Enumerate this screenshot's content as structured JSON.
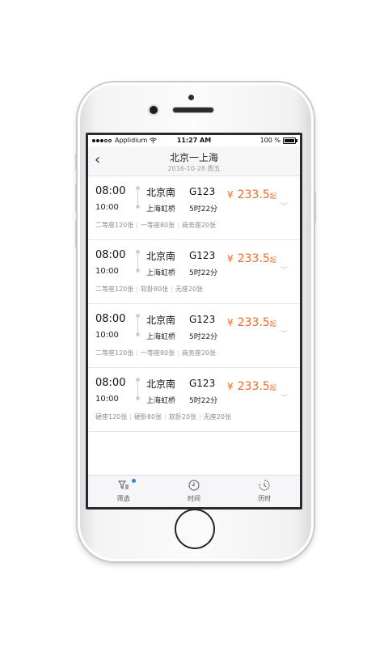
{
  "status_bar": {
    "carrier": "Applidium",
    "time": "11:27 AM",
    "battery": "100 %"
  },
  "nav": {
    "title": "北京一上海",
    "subtitle": "2016-10-28 周五"
  },
  "trains": [
    {
      "depart_time": "08:00",
      "arrive_time": "10:00",
      "from_station": "北京南",
      "to_station": "上海虹桥",
      "train_no": "G123",
      "duration": "5时22分",
      "currency": "¥",
      "price": "233.5",
      "price_suffix": "起",
      "seats": [
        "二等座120张",
        "一等座80张",
        "商务座20张"
      ]
    },
    {
      "depart_time": "08:00",
      "arrive_time": "10:00",
      "from_station": "北京南",
      "to_station": "上海虹桥",
      "train_no": "G123",
      "duration": "5时22分",
      "currency": "¥",
      "price": "233.5",
      "price_suffix": "起",
      "seats": [
        "二等座120张",
        "软卧80张",
        "无座20张"
      ]
    },
    {
      "depart_time": "08:00",
      "arrive_time": "10:00",
      "from_station": "北京南",
      "to_station": "上海虹桥",
      "train_no": "G123",
      "duration": "5时22分",
      "currency": "¥",
      "price": "233.5",
      "price_suffix": "起",
      "seats": [
        "二等座120张",
        "一等座80张",
        "商务座20张"
      ]
    },
    {
      "depart_time": "08:00",
      "arrive_time": "10:00",
      "from_station": "北京南",
      "to_station": "上海虹桥",
      "train_no": "G123",
      "duration": "5时22分",
      "currency": "¥",
      "price": "233.5",
      "price_suffix": "起",
      "seats": [
        "硬座120张",
        "硬卧80张",
        "软卧20张",
        "无座20张"
      ]
    }
  ],
  "tabs": [
    {
      "label": "筛选",
      "icon": "filter-icon"
    },
    {
      "label": "时间",
      "icon": "clock-icon"
    },
    {
      "label": "历时",
      "icon": "timer-icon"
    }
  ],
  "colors": {
    "price": "#f06a1c",
    "badge": "#2e86de"
  }
}
